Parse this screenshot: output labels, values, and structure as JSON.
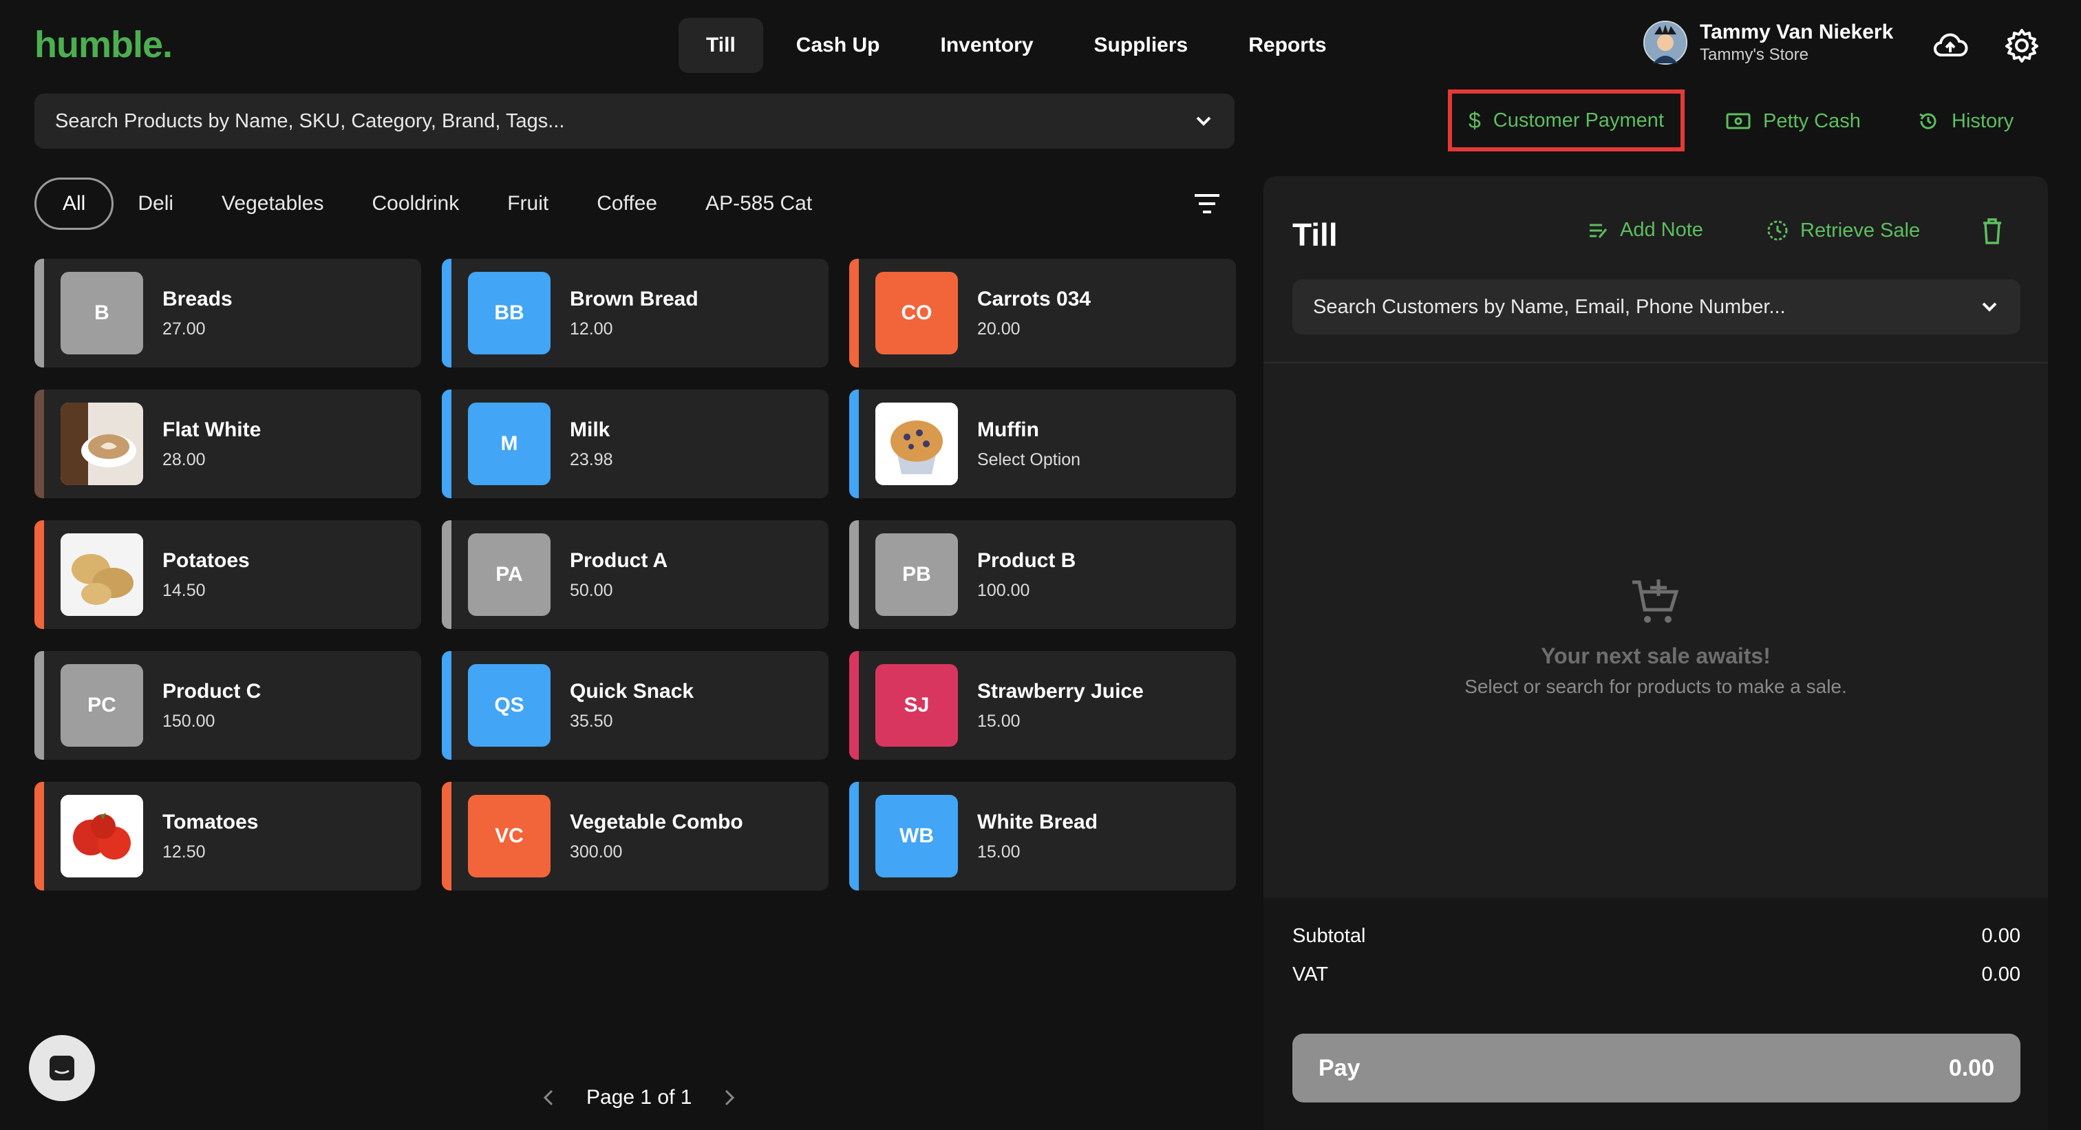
{
  "app": {
    "logo": "humble."
  },
  "nav": [
    {
      "label": "Till",
      "active": true
    },
    {
      "label": "Cash Up"
    },
    {
      "label": "Inventory"
    },
    {
      "label": "Suppliers"
    },
    {
      "label": "Reports"
    }
  ],
  "user": {
    "name": "Tammy Van Niekerk",
    "store": "Tammy's Store"
  },
  "icons": {
    "cloud": "cloud-upload-icon",
    "settings": "gear-icon"
  },
  "search_products": {
    "placeholder": "Search Products by Name, SKU, Category, Brand, Tags..."
  },
  "actions": {
    "customer_payment": "Customer Payment",
    "petty_cash": "Petty Cash",
    "history": "History"
  },
  "categories": [
    "All",
    "Deli",
    "Vegetables",
    "Cooldrink",
    "Fruit",
    "Coffee",
    "AP-585 Cat"
  ],
  "products": [
    {
      "name": "Breads",
      "price": "27.00",
      "initials": "B",
      "color": "#9e9e9e",
      "stripe": "#9e9e9e"
    },
    {
      "name": "Brown Bread",
      "price": "12.00",
      "initials": "BB",
      "color": "#42a5f5",
      "stripe": "#42a5f5"
    },
    {
      "name": "Carrots 034",
      "price": "20.00",
      "initials": "CO",
      "color": "#f2653a",
      "stripe": "#f2653a"
    },
    {
      "name": "Flat White",
      "price": "28.00",
      "initials": "",
      "image": "coffee-image",
      "color": "#6d4c41",
      "stripe": "#6d4c41"
    },
    {
      "name": "Milk",
      "price": "23.98",
      "initials": "M",
      "color": "#42a5f5",
      "stripe": "#42a5f5"
    },
    {
      "name": "Muffin",
      "price": "Select Option",
      "initials": "",
      "image": "muffin-image",
      "color": "#ffffff",
      "stripe": "#42a5f5"
    },
    {
      "name": "Potatoes",
      "price": "14.50",
      "initials": "",
      "image": "potatoes-image",
      "color": "#ffffff",
      "stripe": "#f2653a"
    },
    {
      "name": "Product A",
      "price": "50.00",
      "initials": "PA",
      "color": "#9e9e9e",
      "stripe": "#9e9e9e"
    },
    {
      "name": "Product B",
      "price": "100.00",
      "initials": "PB",
      "color": "#9e9e9e",
      "stripe": "#9e9e9e"
    },
    {
      "name": "Product C",
      "price": "150.00",
      "initials": "PC",
      "color": "#9e9e9e",
      "stripe": "#9e9e9e"
    },
    {
      "name": "Quick Snack",
      "price": "35.50",
      "initials": "QS",
      "color": "#42a5f5",
      "stripe": "#42a5f5"
    },
    {
      "name": "Strawberry Juice",
      "price": "15.00",
      "initials": "SJ",
      "color": "#d8365f",
      "stripe": "#d8365f"
    },
    {
      "name": "Tomatoes",
      "price": "12.50",
      "initials": "",
      "image": "tomatoes-image",
      "color": "#ffffff",
      "stripe": "#f2653a"
    },
    {
      "name": "Vegetable Combo",
      "price": "300.00",
      "initials": "VC",
      "color": "#f2653a",
      "stripe": "#f2653a"
    },
    {
      "name": "White Bread",
      "price": "15.00",
      "initials": "WB",
      "color": "#42a5f5",
      "stripe": "#42a5f5"
    }
  ],
  "pagination": {
    "label": "Page 1 of 1"
  },
  "till": {
    "title": "Till",
    "add_note": "Add Note",
    "retrieve_sale": "Retrieve Sale",
    "customer_search_placeholder": "Search Customers by Name, Email, Phone Number...",
    "empty_title": "Your next sale awaits!",
    "empty_sub": "Select or search for products to make a sale.",
    "subtotal_label": "Subtotal",
    "subtotal_value": "0.00",
    "vat_label": "VAT",
    "vat_value": "0.00",
    "pay_label": "Pay",
    "pay_value": "0.00"
  },
  "colors": {
    "accent": "#5cbf5f",
    "highlight": "#e53935"
  }
}
